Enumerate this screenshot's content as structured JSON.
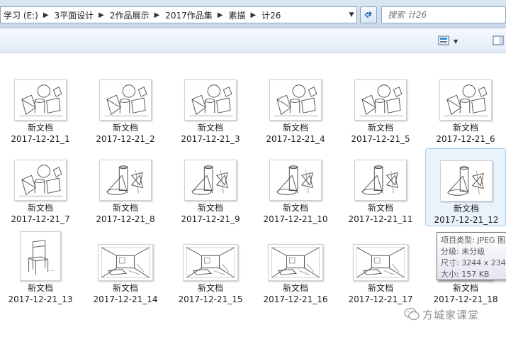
{
  "address_bar": {
    "breadcrumbs": [
      "学习 (E:)",
      "3平面设计",
      "2作品展示",
      "2017作品集",
      "素描",
      "计26"
    ]
  },
  "search": {
    "placeholder": "搜索 计26"
  },
  "items": [
    {
      "line1": "新文档",
      "line2": "2017-12-21_1",
      "art": "still"
    },
    {
      "line1": "新文档",
      "line2": "2017-12-21_2",
      "art": "still"
    },
    {
      "line1": "新文档",
      "line2": "2017-12-21_3",
      "art": "still"
    },
    {
      "line1": "新文档",
      "line2": "2017-12-21_4",
      "art": "still"
    },
    {
      "line1": "新文档",
      "line2": "2017-12-21_5",
      "art": "still"
    },
    {
      "line1": "新文档",
      "line2": "2017-12-21_6",
      "art": "still"
    },
    {
      "line1": "新文档",
      "line2": "2017-12-21_7",
      "art": "still"
    },
    {
      "line1": "新文档",
      "line2": "2017-12-21_8",
      "art": "cone"
    },
    {
      "line1": "新文档",
      "line2": "2017-12-21_9",
      "art": "cone"
    },
    {
      "line1": "新文档",
      "line2": "2017-12-21_10",
      "art": "cone"
    },
    {
      "line1": "新文档",
      "line2": "2017-12-21_11",
      "art": "cone"
    },
    {
      "line1": "新文档",
      "line2": "2017-12-21_12",
      "art": "cone"
    },
    {
      "line1": "新文档",
      "line2": "2017-12-21_13",
      "art": "chair"
    },
    {
      "line1": "新文档",
      "line2": "2017-12-21_14",
      "art": "room"
    },
    {
      "line1": "新文档",
      "line2": "2017-12-21_15",
      "art": "room"
    },
    {
      "line1": "新文档",
      "line2": "2017-12-21_16",
      "art": "room"
    },
    {
      "line1": "新文档",
      "line2": "2017-12-21_17",
      "art": "room"
    },
    {
      "line1": "新文档",
      "line2": "2017-12-21_18",
      "art": "room"
    }
  ],
  "tooltip": {
    "type": "项目类型: JPEG 图",
    "rating": "分级: 未分级",
    "dimensions": "尺寸: 3244 x 234",
    "size": "大小: 157 KB"
  },
  "watermark": {
    "text": "方城家课堂"
  },
  "colors": {
    "accent": "#3a8fd6",
    "hover_bg": "#eaf3fc",
    "hover_border": "#a6cdef"
  }
}
